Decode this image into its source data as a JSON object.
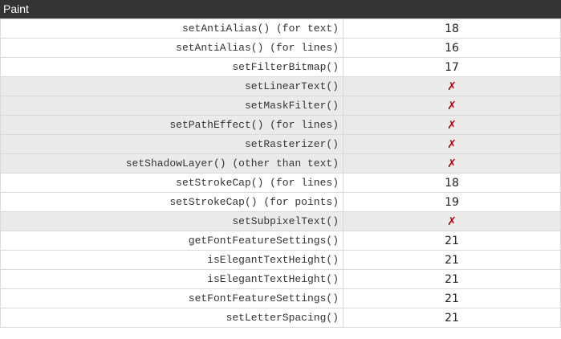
{
  "header": {
    "title": "Paint"
  },
  "unsupported_mark": "✗",
  "colors": {
    "header_bg": "#333333",
    "unsupported_row_bg": "#ebebeb",
    "cross": "#b30000"
  },
  "rows": [
    {
      "api": "setAntiAlias() (for text)",
      "level": "18",
      "supported": true
    },
    {
      "api": "setAntiAlias() (for lines)",
      "level": "16",
      "supported": true
    },
    {
      "api": "setFilterBitmap()",
      "level": "17",
      "supported": true
    },
    {
      "api": "setLinearText()",
      "level": "✗",
      "supported": false
    },
    {
      "api": "setMaskFilter()",
      "level": "✗",
      "supported": false
    },
    {
      "api": "setPathEffect() (for lines)",
      "level": "✗",
      "supported": false
    },
    {
      "api": "setRasterizer()",
      "level": "✗",
      "supported": false
    },
    {
      "api": "setShadowLayer() (other than text)",
      "level": "✗",
      "supported": false
    },
    {
      "api": "setStrokeCap() (for lines)",
      "level": "18",
      "supported": true
    },
    {
      "api": "setStrokeCap() (for points)",
      "level": "19",
      "supported": true
    },
    {
      "api": "setSubpixelText()",
      "level": "✗",
      "supported": false
    },
    {
      "api": "getFontFeatureSettings()",
      "level": "21",
      "supported": true
    },
    {
      "api": "isElegantTextHeight()",
      "level": "21",
      "supported": true
    },
    {
      "api": "isElegantTextHeight()",
      "level": "21",
      "supported": true
    },
    {
      "api": "setFontFeatureSettings()",
      "level": "21",
      "supported": true
    },
    {
      "api": "setLetterSpacing()",
      "level": "21",
      "supported": true
    }
  ]
}
